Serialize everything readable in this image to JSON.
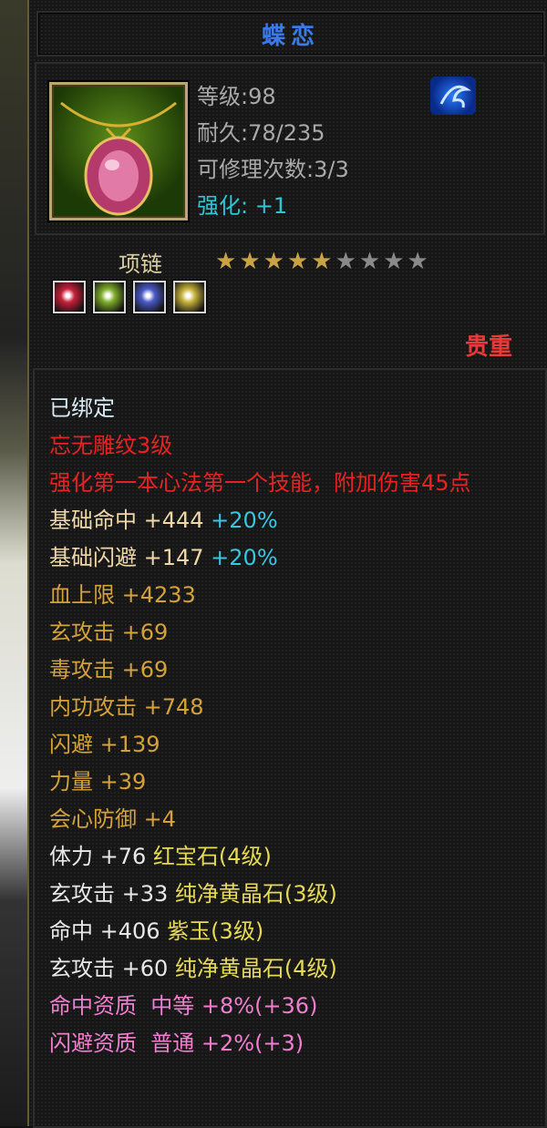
{
  "item": {
    "name": "蝶恋",
    "level": "等级:98",
    "durability": "耐久:78/235",
    "repairs": "可修理次数:3/3",
    "enhance": "强化: +1",
    "type": "项链",
    "rarity": "贵重",
    "stars": {
      "lit": 5,
      "total": 9
    },
    "gems": [
      {
        "name": "red-gem",
        "color": "#c8203a"
      },
      {
        "name": "green-gem",
        "color": "#7fae2a"
      },
      {
        "name": "blue-gem",
        "color": "#4a5ac8"
      },
      {
        "name": "yellow-gem",
        "color": "#c7b23a"
      }
    ]
  },
  "description": {
    "bound": "已绑定",
    "engrave": "忘无雕纹3级",
    "effect": "强化第一本心法第一个技能，附加伤害45点",
    "stats": [
      {
        "text": "基础命中 +444",
        "extra": "+20%",
        "class": "warm"
      },
      {
        "text": "基础闪避 +147",
        "extra": "+20%",
        "class": "warm"
      },
      {
        "text": "血上限 +4233",
        "extra": "",
        "class": "gold"
      },
      {
        "text": "玄攻击 +69",
        "extra": "",
        "class": "gold"
      },
      {
        "text": "毒攻击 +69",
        "extra": "",
        "class": "gold"
      },
      {
        "text": "内功攻击 +748",
        "extra": "",
        "class": "gold"
      },
      {
        "text": "闪避 +139",
        "extra": "",
        "class": "gold"
      },
      {
        "text": "力量 +39",
        "extra": "",
        "class": "gold"
      },
      {
        "text": "会心防御 +4",
        "extra": "",
        "class": "gold"
      }
    ],
    "gem_stats": [
      {
        "text": "体力 +76",
        "gem": "红宝石(4级)"
      },
      {
        "text": "玄攻击 +33",
        "gem": "纯净黄晶石(3级)"
      },
      {
        "text": "命中 +406",
        "gem": "紫玉(3级)"
      },
      {
        "text": "玄攻击 +60",
        "gem": "纯净黄晶石(4级)"
      }
    ],
    "aptitudes": [
      "命中资质  中等 +8%(+36)",
      "闪避资质  普通 +2%(+3)"
    ]
  }
}
